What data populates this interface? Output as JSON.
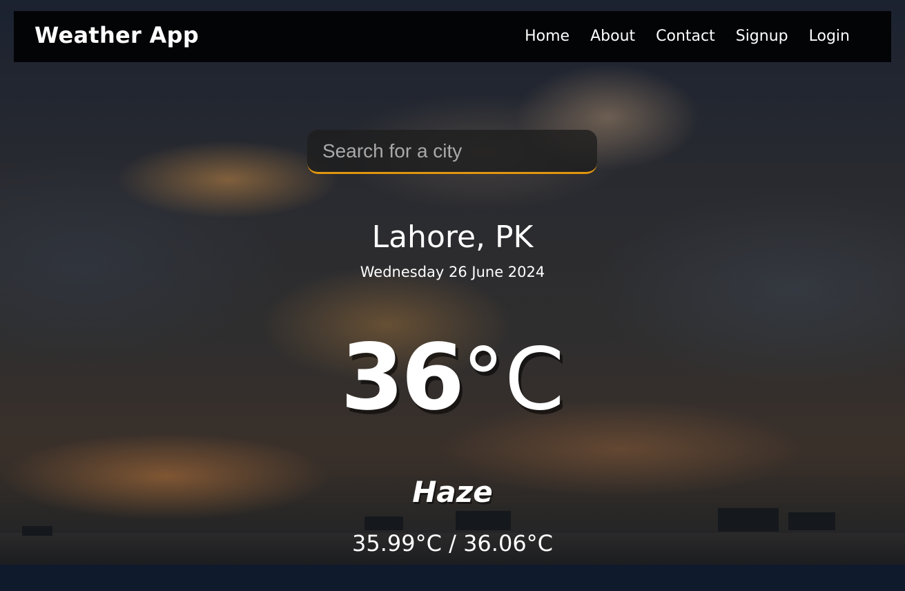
{
  "navbar": {
    "brand": "Weather App",
    "links": [
      "Home",
      "About",
      "Contact",
      "Signup",
      "Login"
    ]
  },
  "search": {
    "placeholder": "Search for a city",
    "value": ""
  },
  "weather": {
    "location": "Lahore, PK",
    "date": "Wednesday 26 June 2024",
    "temperature": "36",
    "unit": "°C",
    "condition": "Haze",
    "hi_low": "35.99°C / 36.06°C"
  },
  "colors": {
    "search_accent": "#e0960f",
    "navbar_bg": "#000000"
  }
}
